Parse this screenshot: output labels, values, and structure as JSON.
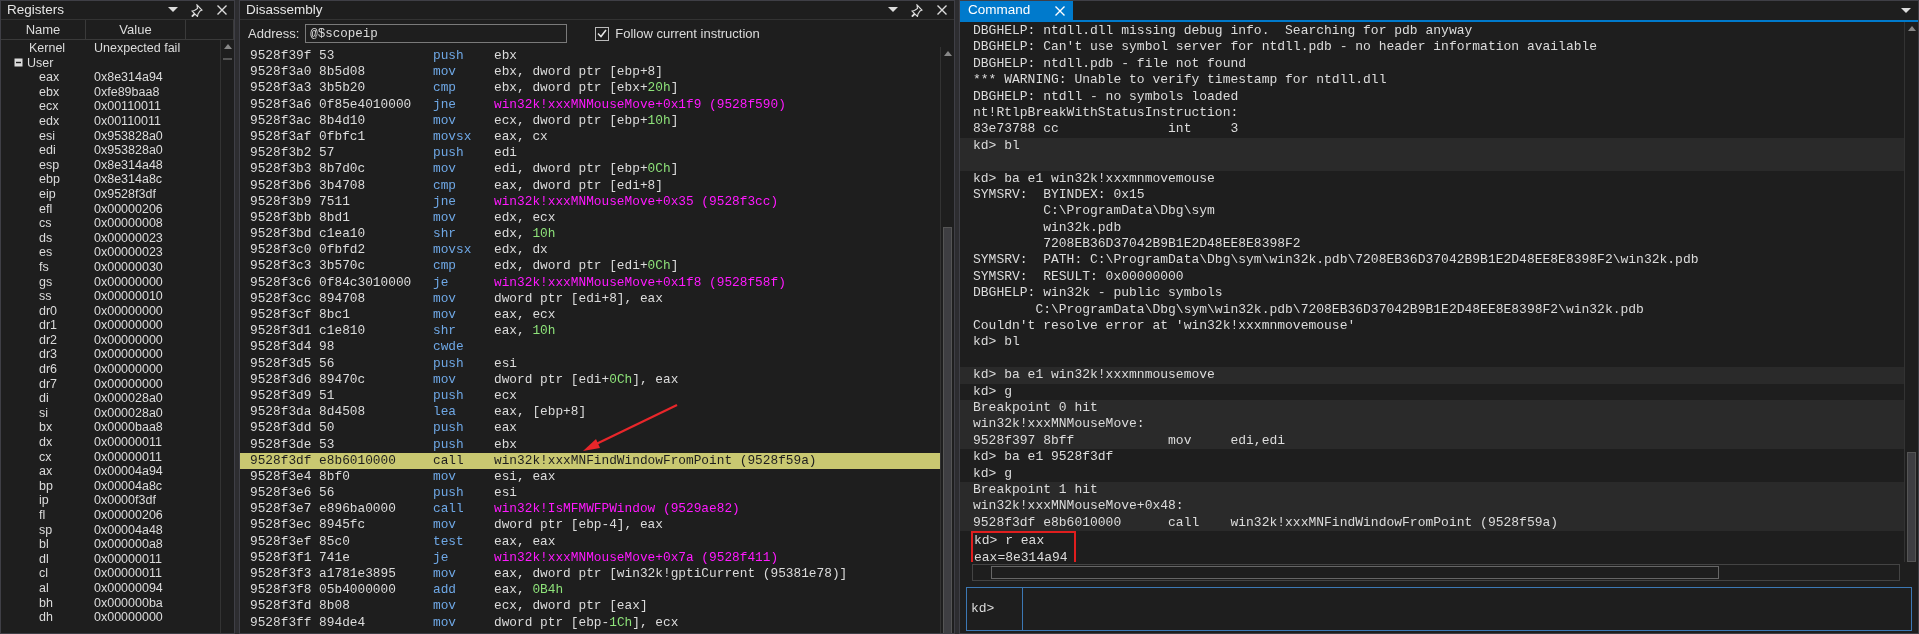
{
  "registers": {
    "title": "Registers",
    "columns": [
      "Name",
      "Value"
    ],
    "rows": [
      {
        "kind": "value",
        "name": "Kernel",
        "value": "Unexpected fail"
      },
      {
        "kind": "group",
        "name": "User",
        "expanded": true,
        "children": [
          {
            "name": "eax",
            "value": "0x8e314a94"
          },
          {
            "name": "ebx",
            "value": "0xfe89baa8"
          },
          {
            "name": "ecx",
            "value": "0x00110011"
          },
          {
            "name": "edx",
            "value": "0x00110011"
          },
          {
            "name": "esi",
            "value": "0x953828a0"
          },
          {
            "name": "edi",
            "value": "0x953828a0"
          },
          {
            "name": "esp",
            "value": "0x8e314a48"
          },
          {
            "name": "ebp",
            "value": "0x8e314a8c"
          },
          {
            "name": "eip",
            "value": "0x9528f3df"
          },
          {
            "name": "efl",
            "value": "0x00000206"
          },
          {
            "name": "cs",
            "value": "0x00000008"
          },
          {
            "name": "ds",
            "value": "0x00000023"
          },
          {
            "name": "es",
            "value": "0x00000023"
          },
          {
            "name": "fs",
            "value": "0x00000030"
          },
          {
            "name": "gs",
            "value": "0x00000000"
          },
          {
            "name": "ss",
            "value": "0x00000010"
          },
          {
            "name": "dr0",
            "value": "0x00000000"
          },
          {
            "name": "dr1",
            "value": "0x00000000"
          },
          {
            "name": "dr2",
            "value": "0x00000000"
          },
          {
            "name": "dr3",
            "value": "0x00000000"
          },
          {
            "name": "dr6",
            "value": "0x00000000"
          },
          {
            "name": "dr7",
            "value": "0x00000000"
          },
          {
            "name": "di",
            "value": "0x000028a0"
          },
          {
            "name": "si",
            "value": "0x000028a0"
          },
          {
            "name": "bx",
            "value": "0x0000baa8"
          },
          {
            "name": "dx",
            "value": "0x00000011"
          },
          {
            "name": "cx",
            "value": "0x00000011"
          },
          {
            "name": "ax",
            "value": "0x00004a94"
          },
          {
            "name": "bp",
            "value": "0x00004a8c"
          },
          {
            "name": "ip",
            "value": "0x0000f3df"
          },
          {
            "name": "fl",
            "value": "0x00000206"
          },
          {
            "name": "sp",
            "value": "0x00004a48"
          },
          {
            "name": "bl",
            "value": "0x000000a8"
          },
          {
            "name": "dl",
            "value": "0x00000011"
          },
          {
            "name": "cl",
            "value": "0x00000011"
          },
          {
            "name": "al",
            "value": "0x00000094"
          },
          {
            "name": "bh",
            "value": "0x000000ba"
          },
          {
            "name": "dh",
            "value": "0x00000000"
          }
        ]
      }
    ]
  },
  "disassembly": {
    "title": "Disassembly",
    "address_label": "Address:",
    "address_value": "@$scopeip",
    "follow": {
      "label": "Follow current instruction",
      "checked": true
    },
    "callout_arrow": true,
    "rows": [
      {
        "address": "9528f39f 53",
        "mnemonic": "push",
        "operand": [
          {
            "kind": "plain",
            "text": "ebx"
          }
        ],
        "current": false
      },
      {
        "address": "9528f3a0 8b5d08",
        "mnemonic": "mov",
        "operand": [
          {
            "kind": "plain",
            "text": "ebx, dword ptr [ebp+8]"
          }
        ],
        "current": false
      },
      {
        "address": "9528f3a3 3b5b20",
        "mnemonic": "cmp",
        "operand": [
          {
            "kind": "plain",
            "text": "ebx, dword ptr [ebx+"
          },
          {
            "kind": "number",
            "text": "20h"
          },
          {
            "kind": "plain",
            "text": "]"
          }
        ],
        "current": false
      },
      {
        "address": "9528f3a6 0f85e4010000",
        "mnemonic": "jne",
        "operand": [
          {
            "kind": "symbol",
            "text": "win32k!xxxMNMouseMove+0x1f9 (9528f590)"
          }
        ],
        "current": false
      },
      {
        "address": "9528f3ac 8b4d10",
        "mnemonic": "mov",
        "operand": [
          {
            "kind": "plain",
            "text": "ecx, dword ptr [ebp+"
          },
          {
            "kind": "number",
            "text": "10h"
          },
          {
            "kind": "plain",
            "text": "]"
          }
        ],
        "current": false
      },
      {
        "address": "9528f3af 0fbfc1",
        "mnemonic": "movsx",
        "operand": [
          {
            "kind": "plain",
            "text": "eax, cx"
          }
        ],
        "current": false
      },
      {
        "address": "9528f3b2 57",
        "mnemonic": "push",
        "operand": [
          {
            "kind": "plain",
            "text": "edi"
          }
        ],
        "current": false
      },
      {
        "address": "9528f3b3 8b7d0c",
        "mnemonic": "mov",
        "operand": [
          {
            "kind": "plain",
            "text": "edi, dword ptr [ebp+"
          },
          {
            "kind": "number",
            "text": "0Ch"
          },
          {
            "kind": "plain",
            "text": "]"
          }
        ],
        "current": false
      },
      {
        "address": "9528f3b6 3b4708",
        "mnemonic": "cmp",
        "operand": [
          {
            "kind": "plain",
            "text": "eax, dword ptr [edi+8]"
          }
        ],
        "current": false
      },
      {
        "address": "9528f3b9 7511",
        "mnemonic": "jne",
        "operand": [
          {
            "kind": "symbol",
            "text": "win32k!xxxMNMouseMove+0x35 (9528f3cc)"
          }
        ],
        "current": false
      },
      {
        "address": "9528f3bb 8bd1",
        "mnemonic": "mov",
        "operand": [
          {
            "kind": "plain",
            "text": "edx, ecx"
          }
        ],
        "current": false
      },
      {
        "address": "9528f3bd c1ea10",
        "mnemonic": "shr",
        "operand": [
          {
            "kind": "plain",
            "text": "edx, "
          },
          {
            "kind": "number",
            "text": "10h"
          }
        ],
        "current": false
      },
      {
        "address": "9528f3c0 0fbfd2",
        "mnemonic": "movsx",
        "operand": [
          {
            "kind": "plain",
            "text": "edx, dx"
          }
        ],
        "current": false
      },
      {
        "address": "9528f3c3 3b570c",
        "mnemonic": "cmp",
        "operand": [
          {
            "kind": "plain",
            "text": "edx, dword ptr [edi+"
          },
          {
            "kind": "number",
            "text": "0Ch"
          },
          {
            "kind": "plain",
            "text": "]"
          }
        ],
        "current": false
      },
      {
        "address": "9528f3c6 0f84c3010000",
        "mnemonic": "je",
        "operand": [
          {
            "kind": "symbol",
            "text": "win32k!xxxMNMouseMove+0x1f8 (9528f58f)"
          }
        ],
        "current": false
      },
      {
        "address": "9528f3cc 894708",
        "mnemonic": "mov",
        "operand": [
          {
            "kind": "plain",
            "text": "dword ptr [edi+8], eax"
          }
        ],
        "current": false
      },
      {
        "address": "9528f3cf 8bc1",
        "mnemonic": "mov",
        "operand": [
          {
            "kind": "plain",
            "text": "eax, ecx"
          }
        ],
        "current": false
      },
      {
        "address": "9528f3d1 c1e810",
        "mnemonic": "shr",
        "operand": [
          {
            "kind": "plain",
            "text": "eax, "
          },
          {
            "kind": "number",
            "text": "10h"
          }
        ],
        "current": false
      },
      {
        "address": "9528f3d4 98",
        "mnemonic": "cwde",
        "operand": [],
        "current": false
      },
      {
        "address": "9528f3d5 56",
        "mnemonic": "push",
        "operand": [
          {
            "kind": "plain",
            "text": "esi"
          }
        ],
        "current": false
      },
      {
        "address": "9528f3d6 89470c",
        "mnemonic": "mov",
        "operand": [
          {
            "kind": "plain",
            "text": "dword ptr [edi+"
          },
          {
            "kind": "number",
            "text": "0Ch"
          },
          {
            "kind": "plain",
            "text": "], eax"
          }
        ],
        "current": false
      },
      {
        "address": "9528f3d9 51",
        "mnemonic": "push",
        "operand": [
          {
            "kind": "plain",
            "text": "ecx"
          }
        ],
        "current": false
      },
      {
        "address": "9528f3da 8d4508",
        "mnemonic": "lea",
        "operand": [
          {
            "kind": "plain",
            "text": "eax, [ebp+8]"
          }
        ],
        "current": false
      },
      {
        "address": "9528f3dd 50",
        "mnemonic": "push",
        "operand": [
          {
            "kind": "plain",
            "text": "eax"
          }
        ],
        "current": false
      },
      {
        "address": "9528f3de 53",
        "mnemonic": "push",
        "operand": [
          {
            "kind": "plain",
            "text": "ebx"
          }
        ],
        "current": false
      },
      {
        "address": "9528f3df e8b6010000",
        "mnemonic": "call",
        "operand": [
          {
            "kind": "symbol",
            "text": "win32k!xxxMNFindWindowFromPoint (9528f59a)"
          }
        ],
        "current": true
      },
      {
        "address": "9528f3e4 8bf0",
        "mnemonic": "mov",
        "operand": [
          {
            "kind": "plain",
            "text": "esi, eax"
          }
        ],
        "current": false
      },
      {
        "address": "9528f3e6 56",
        "mnemonic": "push",
        "operand": [
          {
            "kind": "plain",
            "text": "esi"
          }
        ],
        "current": false
      },
      {
        "address": "9528f3e7 e896ba0000",
        "mnemonic": "call",
        "operand": [
          {
            "kind": "symbol",
            "text": "win32k!IsMFMWFPWindow (9529ae82)"
          }
        ],
        "current": false
      },
      {
        "address": "9528f3ec 8945fc",
        "mnemonic": "mov",
        "operand": [
          {
            "kind": "plain",
            "text": "dword ptr [ebp-4], eax"
          }
        ],
        "current": false
      },
      {
        "address": "9528f3ef 85c0",
        "mnemonic": "test",
        "operand": [
          {
            "kind": "plain",
            "text": "eax, eax"
          }
        ],
        "current": false
      },
      {
        "address": "9528f3f1 741e",
        "mnemonic": "je",
        "operand": [
          {
            "kind": "symbol",
            "text": "win32k!xxxMNMouseMove+0x7a (9528f411)"
          }
        ],
        "current": false
      },
      {
        "address": "9528f3f3 a1781e3895",
        "mnemonic": "mov",
        "operand": [
          {
            "kind": "plain",
            "text": "eax, dword ptr [win32k!gptiCurrent (95381e78)]"
          }
        ],
        "current": false
      },
      {
        "address": "9528f3f8 05b4000000",
        "mnemonic": "add",
        "operand": [
          {
            "kind": "plain",
            "text": "eax, "
          },
          {
            "kind": "number",
            "text": "0B4h"
          }
        ],
        "current": false
      },
      {
        "address": "9528f3fd 8b08",
        "mnemonic": "mov",
        "operand": [
          {
            "kind": "plain",
            "text": "ecx, dword ptr [eax]"
          }
        ],
        "current": false
      },
      {
        "address": "9528f3ff 894de4",
        "mnemonic": "mov",
        "operand": [
          {
            "kind": "plain",
            "text": "dword ptr [ebp-"
          },
          {
            "kind": "number",
            "text": "1Ch"
          },
          {
            "kind": "plain",
            "text": "], ecx"
          }
        ],
        "current": false
      }
    ]
  },
  "command": {
    "title": "Command",
    "prompt": "kd>",
    "blocks": [
      {
        "shaded": false,
        "boxed": false,
        "blank_after": false,
        "lines": [
          "DBGHELP: ntdll.dll missing debug info.  Searching for pdb anyway",
          "DBGHELP: Can't use symbol server for ntdll.pdb - no header information available",
          "DBGHELP: ntdll.pdb - file not found",
          "*** WARNING: Unable to verify timestamp for ntdll.dll",
          "DBGHELP: ntdll - no symbols loaded",
          "nt!RtlpBreakWithStatusInstruction:",
          "83e73788 cc              int     3"
        ]
      },
      {
        "shaded": true,
        "boxed": false,
        "blank_after": true,
        "lines": [
          "kd> bl"
        ]
      },
      {
        "shaded": false,
        "boxed": false,
        "blank_after": false,
        "lines": [
          "kd> ba e1 win32k!xxxmnmovemouse",
          "SYMSRV:  BYINDEX: 0x15",
          "         C:\\ProgramData\\Dbg\\sym",
          "         win32k.pdb",
          "         7208EB36D37042B9B1E2D48EE8E8398F2",
          "SYMSRV:  PATH: C:\\ProgramData\\Dbg\\sym\\win32k.pdb\\7208EB36D37042B9B1E2D48EE8E8398F2\\win32k.pdb",
          "SYMSRV:  RESULT: 0x00000000",
          "DBGHELP: win32k - public symbols",
          "        C:\\ProgramData\\Dbg\\sym\\win32k.pdb\\7208EB36D37042B9B1E2D48EE8E8398F2\\win32k.pdb",
          "Couldn't resolve error at 'win32k!xxxmnmovemouse'"
        ]
      },
      {
        "shaded": false,
        "boxed": false,
        "blank_after": true,
        "lines": [
          "kd> bl"
        ]
      },
      {
        "shaded": true,
        "boxed": false,
        "blank_after": false,
        "lines": [
          "kd> ba e1 win32k!xxxmnmousemove"
        ]
      },
      {
        "shaded": false,
        "boxed": false,
        "blank_after": false,
        "lines": [
          "kd> g"
        ]
      },
      {
        "shaded": true,
        "boxed": false,
        "blank_after": false,
        "lines": [
          "Breakpoint 0 hit",
          "win32k!xxxMNMouseMove:",
          "9528f397 8bff            mov     edi,edi"
        ]
      },
      {
        "shaded": false,
        "boxed": false,
        "blank_after": false,
        "lines": [
          "kd> ba e1 9528f3df",
          "kd> g"
        ]
      },
      {
        "shaded": true,
        "boxed": false,
        "blank_after": false,
        "lines": [
          "Breakpoint 1 hit",
          "win32k!xxxMNMouseMove+0x48:",
          "9528f3df e8b6010000      call    win32k!xxxMNFindWindowFromPoint (9528f59a)"
        ]
      },
      {
        "shaded": false,
        "boxed": true,
        "blank_after": false,
        "lines": [
          "kd> r eax",
          "eax=8e314a94"
        ]
      }
    ]
  }
}
